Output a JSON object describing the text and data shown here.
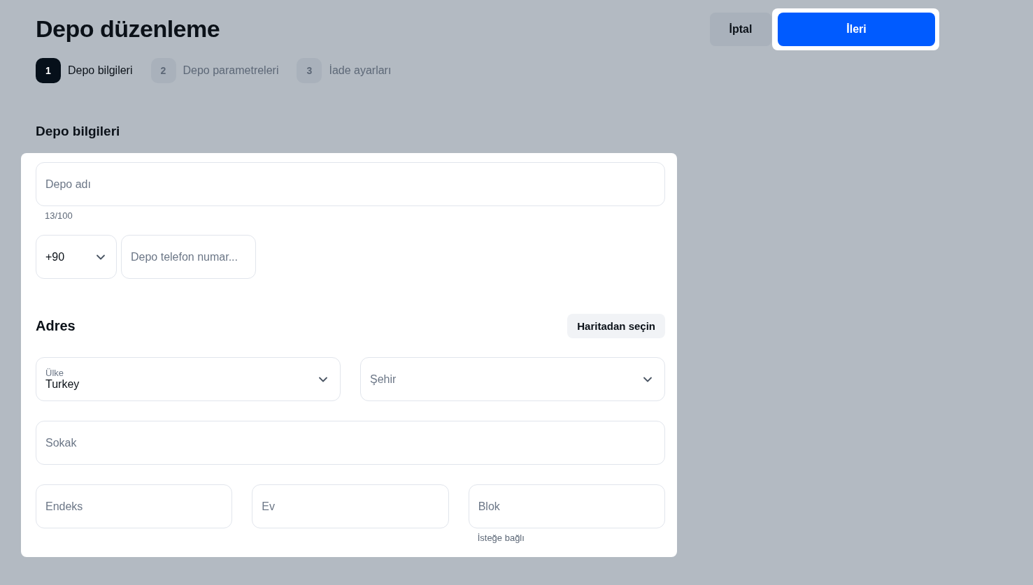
{
  "header": {
    "title": "Depo düzenleme",
    "buttons": [
      {
        "label": "İptal",
        "kind": "secondary"
      },
      {
        "label": "İleri",
        "kind": "primary"
      }
    ]
  },
  "steps": [
    {
      "number": "1",
      "label": "Depo bilgileri",
      "selected": true
    },
    {
      "number": "2",
      "label": "Depo parametreleri",
      "selected": false
    },
    {
      "number": "3",
      "label": "İade ayarları",
      "selected": false
    }
  ],
  "section_title": "Depo bilgileri",
  "name_field": {
    "placeholder": "Depo adı",
    "counter": "13/100"
  },
  "phone": {
    "code": "+90",
    "placeholder": "Depo telefon numar..."
  },
  "address": {
    "title": "Adres",
    "map_button": "Haritadan seçin",
    "rows": [
      [
        {
          "kind": "select",
          "label": "Ülke",
          "value": "Turkey"
        },
        {
          "kind": "select",
          "placeholder": "Şehir"
        }
      ],
      [
        {
          "kind": "text",
          "placeholder": "Sokak"
        }
      ],
      [
        {
          "kind": "text",
          "placeholder": "Endeks"
        },
        {
          "kind": "text",
          "placeholder": "Ev"
        },
        {
          "kind": "text",
          "placeholder": "Blok",
          "hint": "İsteğe bağlı"
        }
      ]
    ]
  }
}
